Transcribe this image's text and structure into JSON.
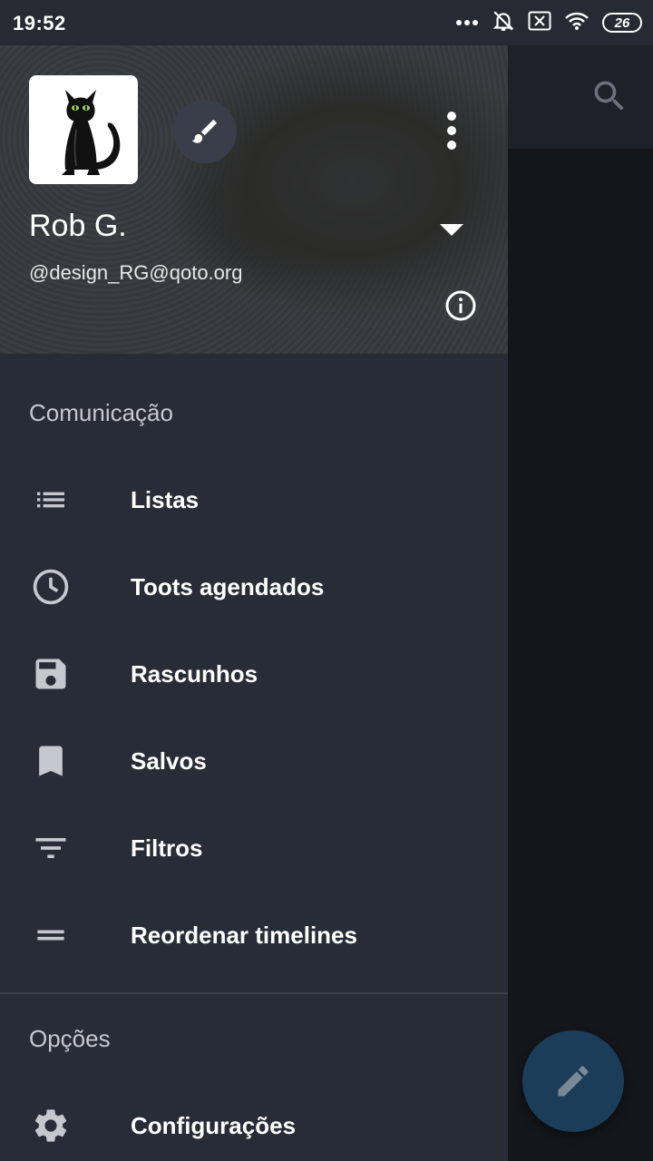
{
  "status_bar": {
    "time": "19:52",
    "battery_level": "26",
    "icons": [
      "more-dots-icon",
      "alarm-off-icon",
      "sim-x-icon",
      "wifi-icon",
      "battery-icon"
    ]
  },
  "drawer": {
    "header": {
      "display_name": "Rob G.",
      "handle": "@design_RG@qoto.org"
    },
    "sections": [
      {
        "title": "Comunicação",
        "items": [
          {
            "label": "Listas",
            "icon": "list-icon"
          },
          {
            "label": "Toots agendados",
            "icon": "clock-icon"
          },
          {
            "label": "Rascunhos",
            "icon": "save-icon"
          },
          {
            "label": "Salvos",
            "icon": "bookmark-icon"
          },
          {
            "label": "Filtros",
            "icon": "filter-icon"
          },
          {
            "label": "Reordenar timelines",
            "icon": "reorder-icon"
          }
        ]
      },
      {
        "title": "Opções",
        "items": [
          {
            "label": "Configurações",
            "icon": "gear-icon"
          }
        ]
      }
    ]
  },
  "colors": {
    "drawer_bg": "#282c37",
    "fab_bg": "#1c3d5a",
    "status_bar_bg": "#272a33"
  }
}
